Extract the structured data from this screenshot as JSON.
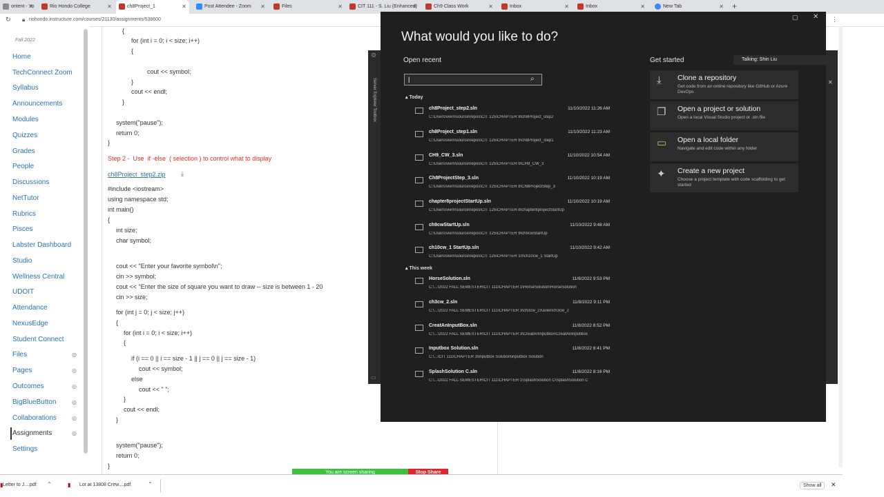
{
  "browser": {
    "tabs": [
      {
        "label": "ontent - Yo",
        "color": "#8a8a8a"
      },
      {
        "label": "Rio Hondo College",
        "color": "#c0392b"
      },
      {
        "label": "ch8Project_1",
        "color": "#c0392b",
        "active": true
      },
      {
        "label": "Post Attendee - Zoom",
        "color": "#2d8cff"
      },
      {
        "label": "Files",
        "color": "#c0392b"
      },
      {
        "label": "CIT 111 - S. Liu (Enhanced)",
        "color": "#c0392b"
      },
      {
        "label": "Ch9 Class Work",
        "color": "#c0392b"
      },
      {
        "label": "Inbox",
        "color": "#c0392b"
      },
      {
        "label": "Inbox",
        "color": "#c0392b"
      },
      {
        "label": "New Tab",
        "color": "#4285f4"
      }
    ],
    "new_tab_glyph": "+",
    "address": "riohondo.instructure.com/courses/21130/assignments/538600"
  },
  "canvas_nav": {
    "term": "Fall 2022",
    "items": [
      {
        "label": "Home"
      },
      {
        "label": "TechConnect Zoom"
      },
      {
        "label": "Syllabus"
      },
      {
        "label": "Announcements"
      },
      {
        "label": "Modules"
      },
      {
        "label": "Quizzes"
      },
      {
        "label": "Grades"
      },
      {
        "label": "People"
      },
      {
        "label": "Discussions"
      },
      {
        "label": "NetTutor"
      },
      {
        "label": "Rubrics"
      },
      {
        "label": "Pisces"
      },
      {
        "label": "Labster Dashboard"
      },
      {
        "label": "Studio"
      },
      {
        "label": "Wellness Central"
      },
      {
        "label": "UDOIT"
      },
      {
        "label": "Attendance"
      },
      {
        "label": "NexusEdge"
      },
      {
        "label": "Student Connect"
      },
      {
        "label": "Files",
        "hidden": true
      },
      {
        "label": "Pages",
        "hidden": true
      },
      {
        "label": "Outcomes",
        "hidden": true
      },
      {
        "label": "BigBlueButton",
        "hidden": true
      },
      {
        "label": "Collaborations",
        "hidden": true
      },
      {
        "label": "Assignments",
        "hidden": true,
        "active": true
      },
      {
        "label": "Settings"
      }
    ]
  },
  "content": {
    "code_top": [
      "{",
      "for (int i = 0; i < size; i++)",
      "{",
      "cout << symbol;",
      "}",
      "cout << endl;",
      "}",
      "system(\"pause\");",
      "return 0;",
      "}"
    ],
    "step2_heading": "Step 2 -  Use  if -else  ( selection ) to control what to display",
    "file_link": "ch8Project_step2.zip",
    "code_bottom": [
      "#include <iostream>",
      "using namespace std;",
      "int main()",
      "{",
      "int size;",
      "char symbol;",
      "cout << \"Enter your favorite symbol\\n\";",
      "cin >> symbol;",
      "cout << \"Enter the size of square you want to draw -- size is between 1 - 20",
      "cin >> size;",
      "for (int j = 0; j < size; j++)",
      "{",
      "for (int i = 0; i < size; i++)",
      "{",
      "if (i == 0 || i == size - 1 || j == 0 || j == size - 1)",
      "cout << symbol;",
      "else",
      "cout << \" \";",
      "}",
      "cout << endl;",
      "}",
      "system(\"pause\");",
      "return 0;",
      "}"
    ]
  },
  "vs": {
    "title": "What would you like to do?",
    "open_recent": "Open recent",
    "search_value": "|",
    "groups": {
      "today": "Today",
      "this_week": "This week"
    },
    "recent": [
      {
        "name": "ch8Project_step2.sln",
        "date": "11/10/2022 11:26 AM",
        "path": "C:\\Users\\viern\\source\\repos\\CIT 125\\CHAPTER 8\\ch8Project_step2"
      },
      {
        "name": "ch8Project_step1.sln",
        "date": "11/10/2022 11:23 AM",
        "path": "C:\\Users\\viern\\source\\repos\\CIT 125\\CHAPTER 8\\ch8Project_step1"
      },
      {
        "name": "CH9_CW_3.sln",
        "date": "11/10/2022 10:54 AM",
        "path": "C:\\Users\\viern\\source\\repos\\CIT 125\\CHAPTER 9\\CH9_CW_3"
      },
      {
        "name": "Ch8ProjectStep_3.sln",
        "date": "11/10/2022 10:19 AM",
        "path": "C:\\Users\\viern\\source\\repos\\CIT 125\\CHAPTER 8\\Ch8ProjectStep_3"
      },
      {
        "name": "chapter8projectStartUp.sln",
        "date": "11/10/2022 10:19 AM",
        "path": "C:\\Users\\viern\\source\\repos\\CIT 125\\CHAPTER 8\\chapter8projectStartUp"
      },
      {
        "name": "ch9cwStartUp.sln",
        "date": "11/10/2022 9:48 AM",
        "path": "C:\\Users\\viern\\source\\repos\\CIT 125\\CHAPTER 9\\ch9cwStartUp"
      },
      {
        "name": "ch10cw_1 StartUp.sln",
        "date": "11/10/2022 9:42 AM",
        "path": "C:\\Users\\viern\\source\\repos\\CIT 125\\CHAPTER 10\\ch10cw_1 StartUp"
      },
      {
        "name": "HorseSolution.sln",
        "date": "11/8/2022 9:53 PM",
        "path": "C:\\...\\2022 FALL SEMESTER\\CIT 111\\CHAPTER 1\\HorseSolution\\HorseSolution"
      },
      {
        "name": "ch3cw_2.sln",
        "date": "11/8/2022 9:11 PM",
        "path": "C:\\...\\2022 FALL SEMESTER\\CIT 111\\CHAPTER 3\\ch3cw_2Xavier\\ch3cw_2"
      },
      {
        "name": "CreatAnInputBox.sln",
        "date": "11/8/2022 8:52 PM",
        "path": "C:\\...\\2022 FALL SEMESTER\\CIT 111\\CHAPTER 3\\CreatAnInputBox\\CreatAnInputBox"
      },
      {
        "name": "Inputbox Solution.sln",
        "date": "11/8/2022 8:41 PM",
        "path": "C:\\...\\CIT 111\\CHAPTER 3\\Inputbox Solution\\inputbox Solution"
      },
      {
        "name": "SplashSolution C.sln",
        "date": "11/8/2022 8:16 PM",
        "path": "C:\\...\\2022 FALL SEMESTER\\CIT 111\\CHAPTER 1\\SplashSolution C\\SplashSolution C"
      }
    ],
    "get_started": "Get started",
    "actions": [
      {
        "title": "Clone a repository",
        "desc": "Get code from an online repository like GitHub or Azure DevOps",
        "icon": "clone-icon"
      },
      {
        "title": "Open a project or solution",
        "desc": "Open a local Visual Studio project or .sln file",
        "icon": "open-project-icon"
      },
      {
        "title": "Open a local folder",
        "desc": "Navigate and edit code within any folder",
        "icon": "folder-icon"
      },
      {
        "title": "Create a new project",
        "desc": "Choose a project template with code scaffolding to get started",
        "icon": "new-project-icon"
      }
    ],
    "side_tabs": "Server Explorer   Toolbox"
  },
  "zoom": {
    "talking": "Talking: Shin Liu",
    "sharing": "You are screen sharing",
    "stop": "Stop Share"
  },
  "downloads": {
    "items": [
      "Letter to J....pdf",
      "Lot at 13808 Crew....pdf"
    ],
    "show_all": "Show all"
  }
}
